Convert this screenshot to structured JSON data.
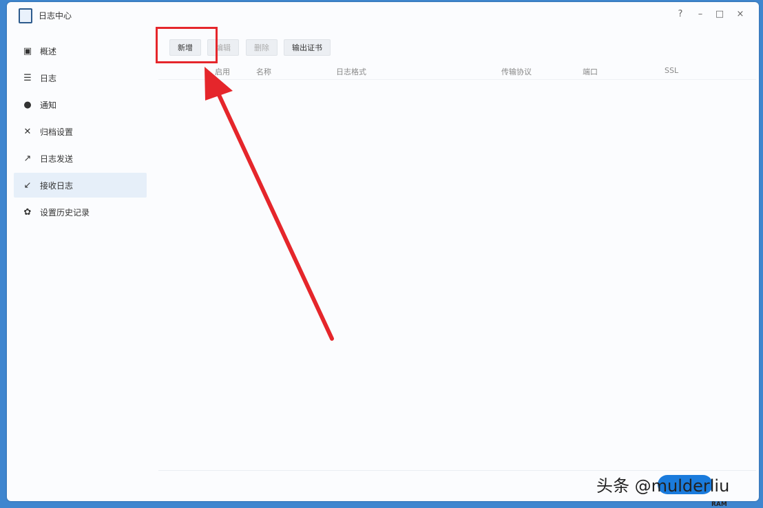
{
  "window": {
    "title": "日志中心",
    "controls": {
      "help": "?",
      "minimize": "–",
      "maximize": "□",
      "close": "×"
    }
  },
  "sidebar": {
    "items": [
      {
        "label": "概述",
        "icon": "overview-icon",
        "active": false
      },
      {
        "label": "日志",
        "icon": "list-icon",
        "active": false
      },
      {
        "label": "通知",
        "icon": "chat-bubble-icon",
        "active": false
      },
      {
        "label": "归档设置",
        "icon": "tools-icon",
        "active": false
      },
      {
        "label": "日志发送",
        "icon": "send-icon",
        "active": false
      },
      {
        "label": "接收日志",
        "icon": "receive-icon",
        "active": true
      },
      {
        "label": "设置历史记录",
        "icon": "gear-icon",
        "active": false
      }
    ]
  },
  "toolbar": {
    "new_label": "新增",
    "edit_label": "编辑",
    "delete_label": "删除",
    "export_label": "输出证书"
  },
  "table": {
    "columns": [
      "启用",
      "名称",
      "日志格式",
      "传输协议",
      "端口",
      "SSL"
    ]
  },
  "watermark": "头条 @mulderliu",
  "background_fragment": "RAM",
  "colors": {
    "annotation": "#e5262b",
    "accent": "#1a7bdc",
    "active_nav_bg": "#e6eff9"
  }
}
